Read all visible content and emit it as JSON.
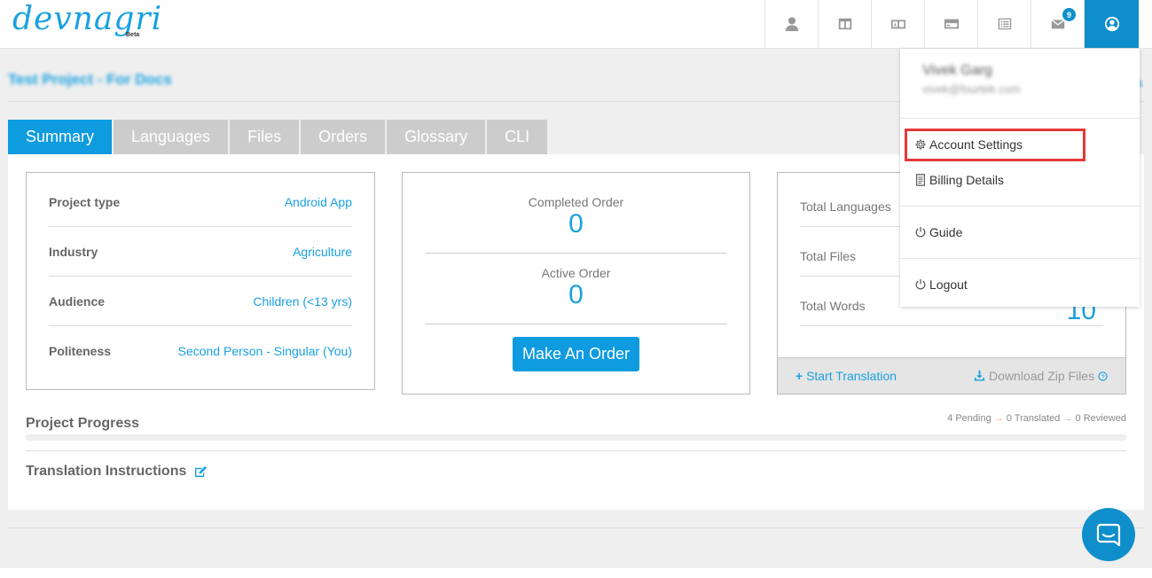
{
  "app": {
    "logo_text": "devnagri",
    "logo_badge": "Beta",
    "nav_badge_count": "9"
  },
  "project": {
    "title": "Test Project - For Docs",
    "right_link": "s"
  },
  "tabs": [
    {
      "label": "Summary",
      "active": true
    },
    {
      "label": "Languages"
    },
    {
      "label": "Files"
    },
    {
      "label": "Orders"
    },
    {
      "label": "Glossary"
    },
    {
      "label": "CLI"
    }
  ],
  "details": [
    {
      "key": "Project type",
      "value": "Android App"
    },
    {
      "key": "Industry",
      "value": "Agriculture"
    },
    {
      "key": "Audience",
      "value": "Children (<13 yrs)"
    },
    {
      "key": "Politeness",
      "value": "Second Person - Singular (You)"
    }
  ],
  "orders": {
    "completed_label": "Completed Order",
    "completed_value": "0",
    "active_label": "Active Order",
    "active_value": "0",
    "button_label": "Make An Order"
  },
  "stats": {
    "languages_label": "Total Languages",
    "files_label": "Total Files",
    "words_label": "Total Words",
    "words_value": "10",
    "start_translation": "Start Translation",
    "download_zip": "Download Zip Files"
  },
  "progress": {
    "title": "Project Progress",
    "pending": "4 Pending",
    "translated": "0 Translated",
    "reviewed": "0 Reviewed"
  },
  "instructions": {
    "title": "Translation Instructions"
  },
  "user_menu": {
    "name": "Vivek Garg",
    "email": "vivek@fourtek.com",
    "items": [
      {
        "label": "Account Settings",
        "icon": "gear-icon"
      },
      {
        "label": "Billing Details",
        "icon": "document-icon"
      },
      {
        "label": "Guide",
        "icon": "power-icon"
      },
      {
        "label": "Logout",
        "icon": "power-icon"
      }
    ]
  },
  "colors": {
    "accent": "#0e9be0",
    "link": "#1aa1e0",
    "highlight": "#e53939"
  }
}
